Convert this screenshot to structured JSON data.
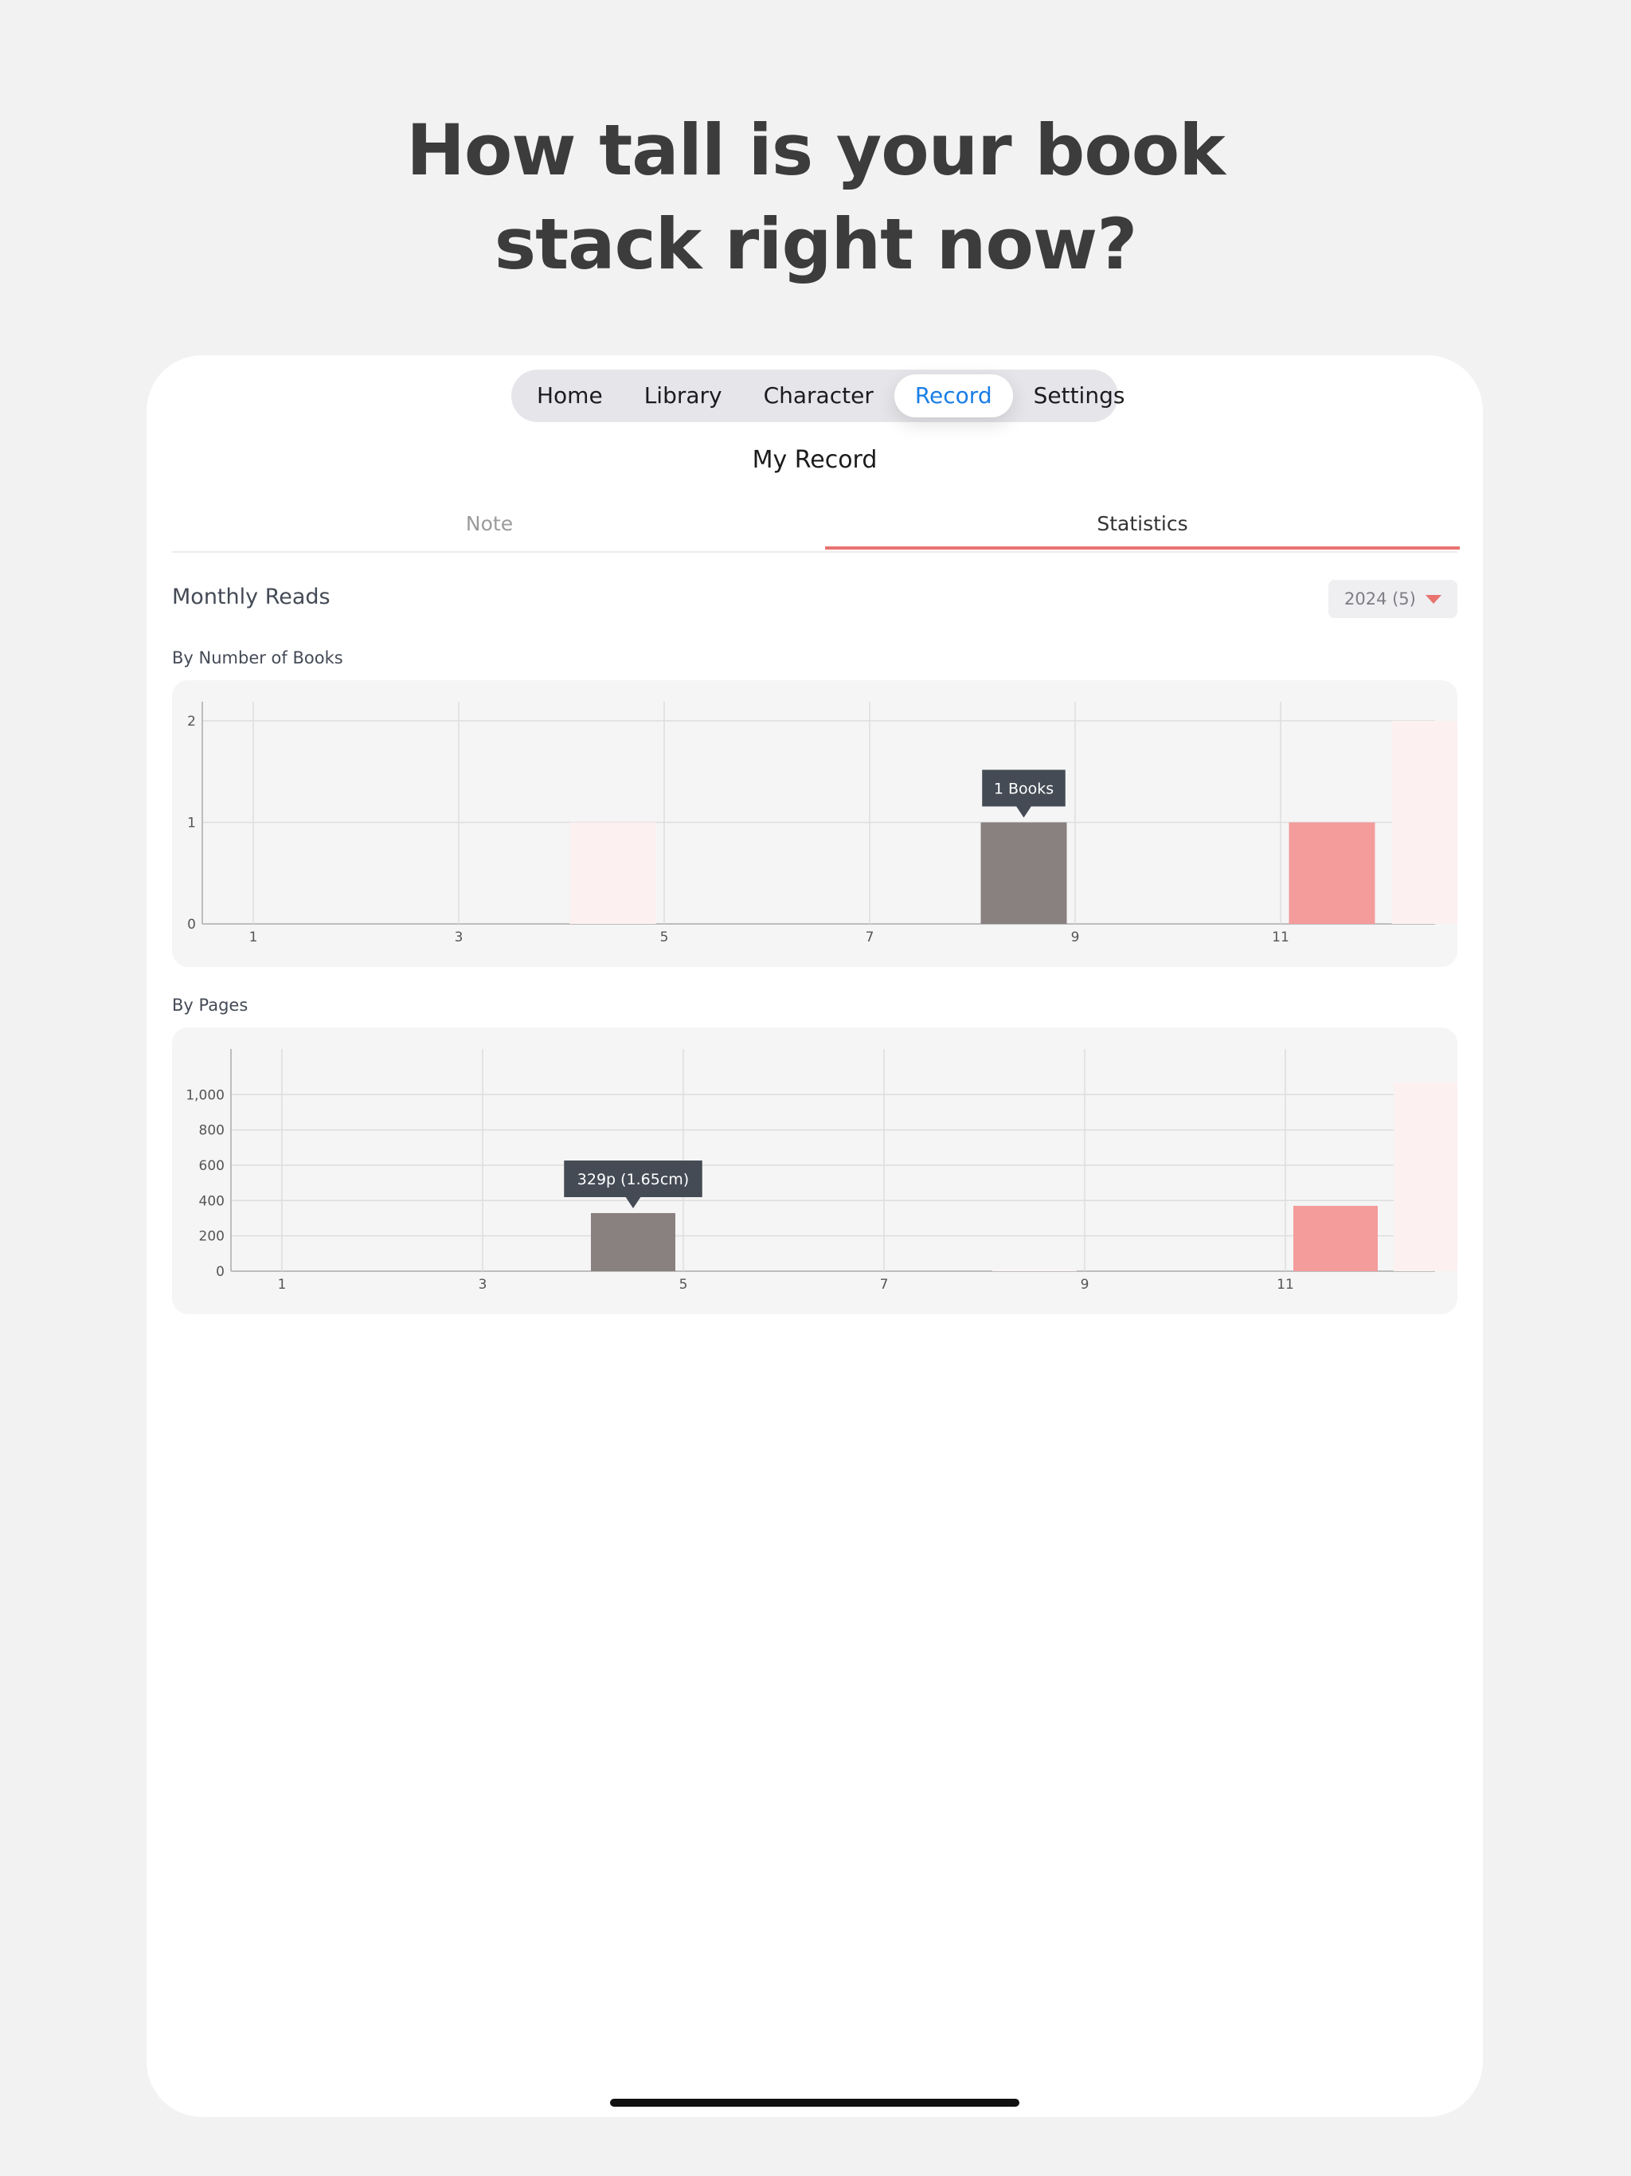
{
  "headline": [
    "How tall is your book",
    "stack right now?"
  ],
  "tabs": [
    {
      "label": "Home",
      "active": false
    },
    {
      "label": "Library",
      "active": false
    },
    {
      "label": "Character",
      "active": false
    },
    {
      "label": "Record",
      "active": true
    },
    {
      "label": "Settings",
      "active": false
    }
  ],
  "page_title": "My Record",
  "segments": {
    "note": "Note",
    "statistics": "Statistics",
    "selected": "Statistics"
  },
  "section_title": "Monthly Reads",
  "year_select": {
    "value": "2024 (5)"
  },
  "colors": {
    "accent": "#e8736f",
    "selected_bar": "#888180",
    "current_bar": "#f49b9b",
    "future_bar": "#fdf0f0",
    "tooltip": "#444b55",
    "tab_active": "#1a7ee6"
  },
  "chart_data": [
    {
      "type": "bar",
      "title": "By Number of Books",
      "x": [
        1,
        2,
        3,
        4,
        5,
        6,
        7,
        8,
        9,
        10,
        11,
        12
      ],
      "values": [
        0,
        0,
        0,
        1,
        0,
        0,
        0,
        1,
        0,
        0,
        1,
        2
      ],
      "x_tick_labels": [
        "1",
        "3",
        "5",
        "7",
        "9",
        "11"
      ],
      "y_tick_labels": [
        "0",
        "1",
        "2"
      ],
      "ylim": [
        0,
        2
      ],
      "highlighted_month": 8,
      "current_month": 11,
      "faded_months": [
        4,
        12
      ],
      "tooltip": "1 Books",
      "grid": true
    },
    {
      "type": "bar",
      "title": "By Pages",
      "x": [
        1,
        2,
        3,
        4,
        5,
        6,
        7,
        8,
        9,
        10,
        11,
        12
      ],
      "values": [
        0,
        0,
        0,
        329,
        0,
        0,
        0,
        5,
        0,
        0,
        370,
        1070
      ],
      "x_tick_labels": [
        "1",
        "3",
        "5",
        "7",
        "9",
        "11"
      ],
      "y_tick_labels": [
        "0",
        "200",
        "400",
        "600",
        "800",
        "1,000"
      ],
      "ylim": [
        0,
        1150
      ],
      "highlighted_month": 4,
      "current_month": 11,
      "faded_months": [
        8,
        12
      ],
      "tooltip": "329p (1.65cm)",
      "grid": true
    }
  ]
}
